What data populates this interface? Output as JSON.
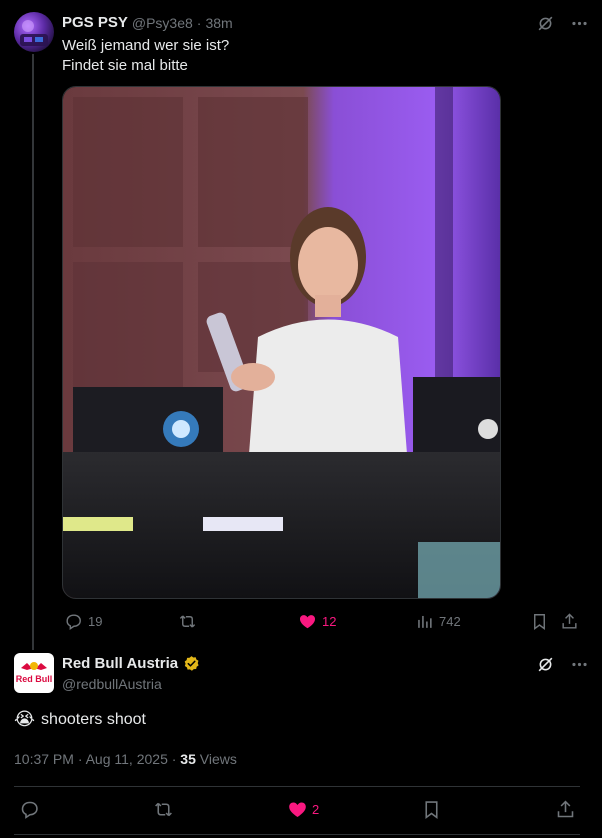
{
  "post1": {
    "name": "PGS PSY",
    "handle": "@Psy3e8",
    "separator": "·",
    "time": "38m",
    "text_lines": [
      "Weiß jemand wer sie ist?",
      "Findet sie mal bitte"
    ],
    "replies": "19",
    "likes": "12",
    "views": "742"
  },
  "post2": {
    "name": "Red Bull Austria",
    "handle": "@redbullAustria",
    "emoji": "😭",
    "text": "shooters shoot",
    "meta_time": "10:37 PM · Aug 11, 2025 · ",
    "views_count": "35",
    "views_label": " Views",
    "likes": "2",
    "avatar_text": "Red Bull"
  },
  "colors": {
    "like_pink": "#f91880",
    "muted": "#71767b",
    "verified_gold": "#e2b719",
    "redbull_red": "#db0a40"
  },
  "icons": [
    "grok-icon",
    "more-icon",
    "reply-icon",
    "retweet-icon",
    "heart-icon",
    "views-icon",
    "bookmark-icon",
    "share-icon",
    "verified-badge-icon"
  ]
}
